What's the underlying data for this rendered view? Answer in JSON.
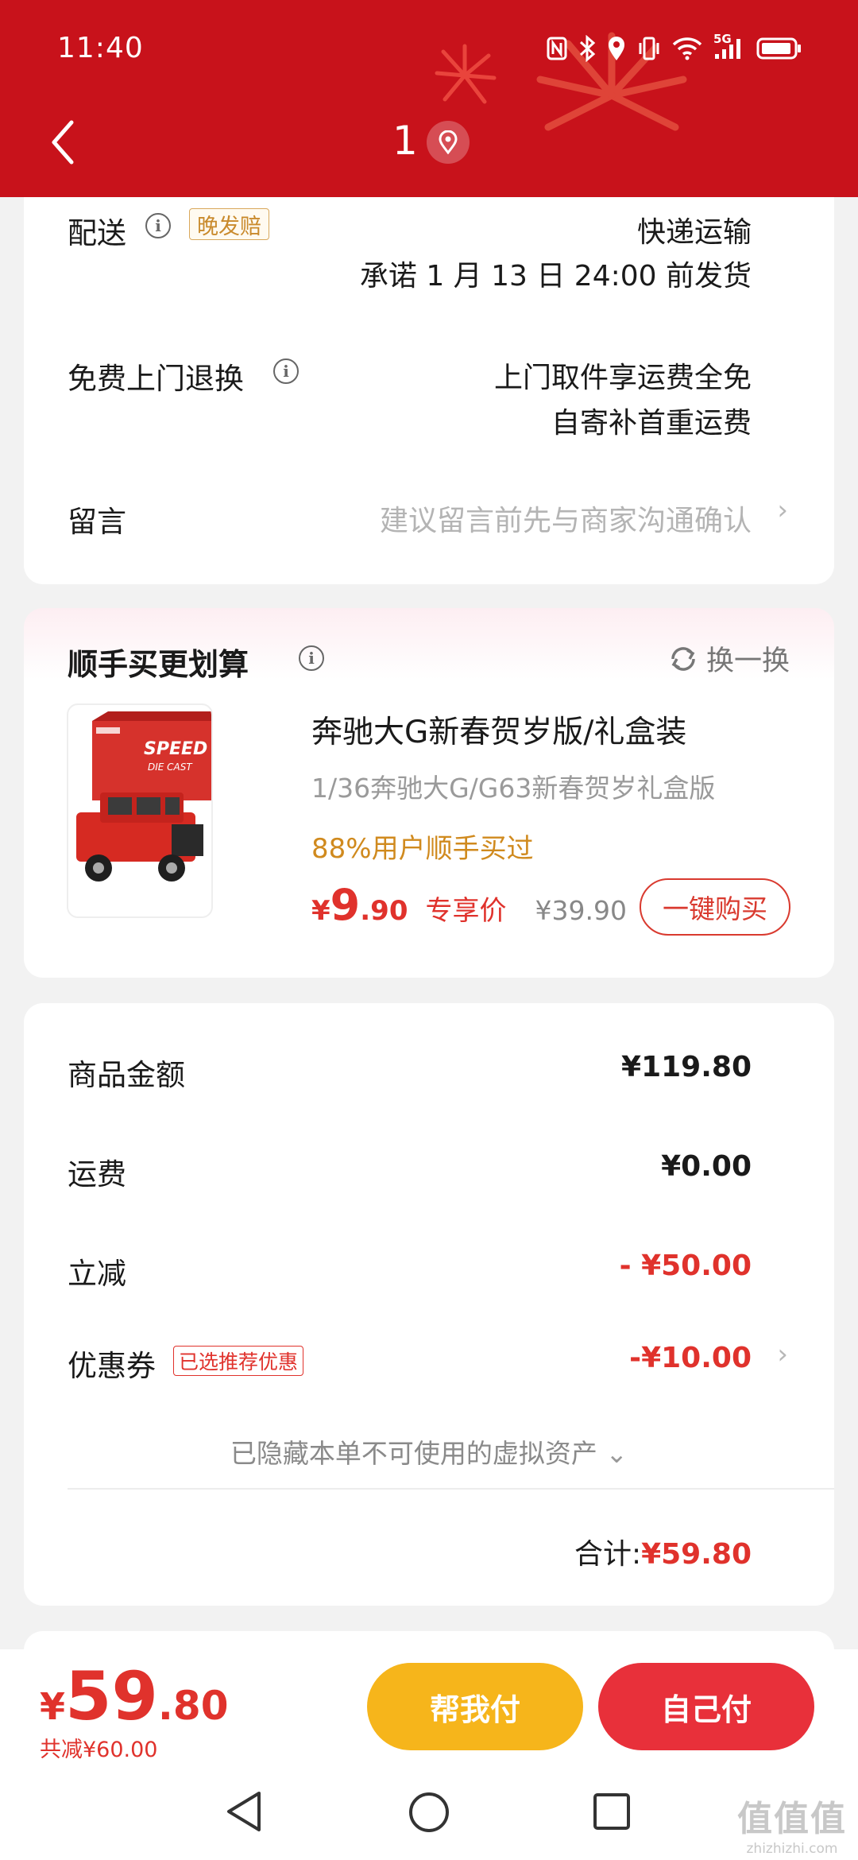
{
  "status_bar": {
    "time": "11:40",
    "network": "5G"
  },
  "nav": {
    "title": "1"
  },
  "delivery": {
    "label": "配送",
    "badge": "晚发赔",
    "method": "快递运输",
    "promise": "承诺 1 月 13 日 24:00 前发货"
  },
  "returns": {
    "label": "免费上门退换",
    "line1": "上门取件享运费全免",
    "line2": "自寄补首重运费"
  },
  "message": {
    "label": "留言",
    "placeholder": "建议留言前先与商家沟通确认"
  },
  "addon": {
    "title": "顺手买更划算",
    "swap_label": "换一换",
    "product": {
      "name": "奔驰大G新春贺岁版/礼盒装",
      "spec": "1/36奔驰大G/G63新春贺岁礼盒版",
      "bought": "88%用户顺手买过",
      "price_symbol": "¥",
      "price_int": "9",
      "price_dec": ".90",
      "exclusive_label": "专享价",
      "original_price": "¥39.90",
      "buy_label": "一键购买"
    }
  },
  "summary": {
    "goods_label": "商品金额",
    "goods_value": "¥119.80",
    "shipping_label": "运费",
    "shipping_value": "¥0.00",
    "discount_label": "立减",
    "discount_value": "- ¥50.00",
    "coupon_label": "优惠券",
    "coupon_badge": "已选推荐优惠",
    "coupon_value": "-¥10.00",
    "hidden_assets": "已隐藏本单不可使用的虚拟资产",
    "total_label": "合计:",
    "total_value": "¥59.80"
  },
  "bottom": {
    "price_symbol": "¥",
    "price_int": "59",
    "price_dec": ".80",
    "saved": "共减¥60.00",
    "help_pay": "帮我付",
    "self_pay": "自己付"
  },
  "watermark": {
    "logo": "值值值",
    "text": "zhizhizhi.com"
  },
  "colors": {
    "header": "#c8121b",
    "accent_red": "#e0322c",
    "help_yellow": "#f6b51b",
    "pay_red": "#e8303a"
  }
}
